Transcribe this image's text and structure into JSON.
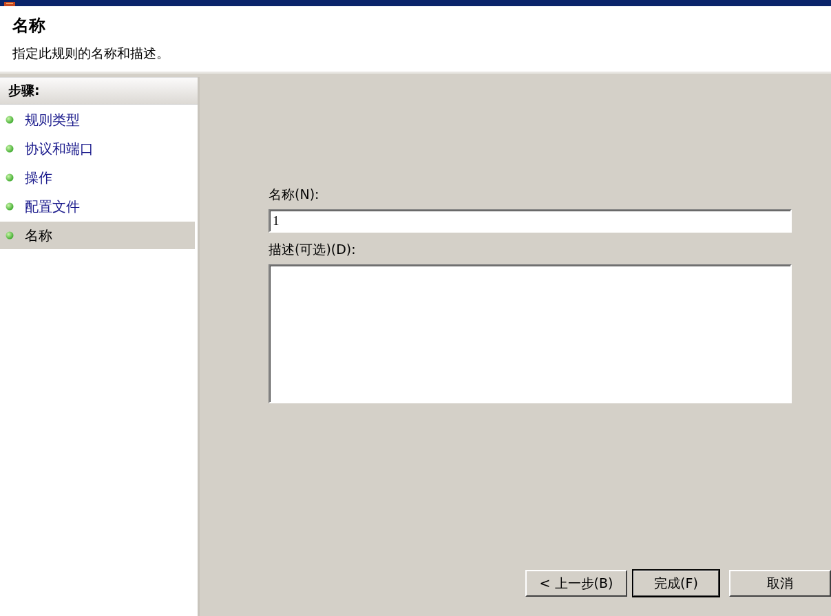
{
  "header": {
    "title": "名称",
    "subtitle": "指定此规则的名称和描述。"
  },
  "steps": {
    "heading": "步骤:",
    "items": [
      {
        "label": "规则类型",
        "selected": false
      },
      {
        "label": "协议和端口",
        "selected": false
      },
      {
        "label": "操作",
        "selected": false
      },
      {
        "label": "配置文件",
        "selected": false
      },
      {
        "label": "名称",
        "selected": true
      }
    ]
  },
  "form": {
    "name_label": "名称(N):",
    "name_value": "1",
    "description_label": "描述(可选)(D):"
  },
  "buttons": [
    {
      "label": "< 上一步(B)",
      "default": false
    },
    {
      "label": "完成(F)",
      "default": true
    },
    {
      "label": "取消",
      "default": false
    }
  ]
}
